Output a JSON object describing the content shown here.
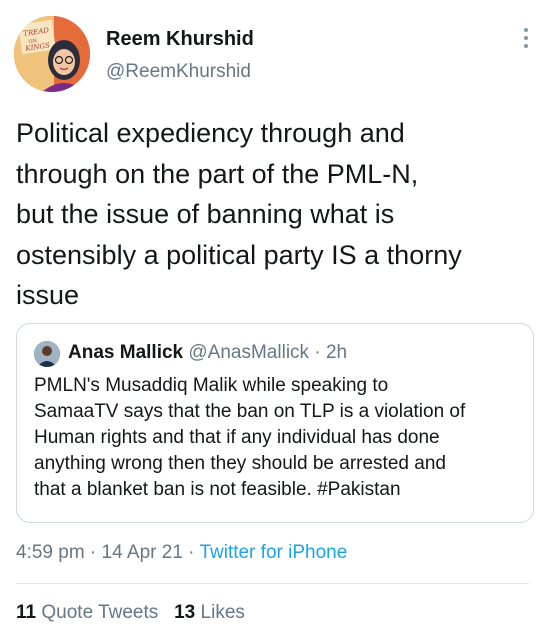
{
  "author": {
    "name": "Reem Khurshid",
    "handle": "@ReemKhurshid",
    "avatar_sign_text": "TREAD ON KINGS"
  },
  "tweet": {
    "text": "Political expediency through and\nthrough on the part of the PML-N,\nbut the issue of banning what is\nostensibly a political party IS a thorny\nissue"
  },
  "quoted": {
    "name": "Anas Mallick",
    "handle": "@AnasMallick",
    "separator": " · ",
    "time": "2h",
    "text": "PMLN's Musaddiq Malik while speaking to\nSamaaTV says that the ban on TLP is a violation of\nHuman rights and that if any individual has done\nanything wrong then they should be arrested and\nthat a blanket ban is not feasible. #Pakistan"
  },
  "meta": {
    "time": "4:59 pm",
    "separator": " · ",
    "date": "14 Apr 21",
    "source": "Twitter for iPhone"
  },
  "stats": {
    "quote_tweets_count": "11",
    "quote_tweets_label": "Quote Tweets",
    "likes_count": "13",
    "likes_label": "Likes"
  },
  "icons": {
    "more": "vertical-dots-icon"
  },
  "colors": {
    "secondary_text": "#657786",
    "link": "#1da1f2",
    "border": "#cfd9de"
  }
}
